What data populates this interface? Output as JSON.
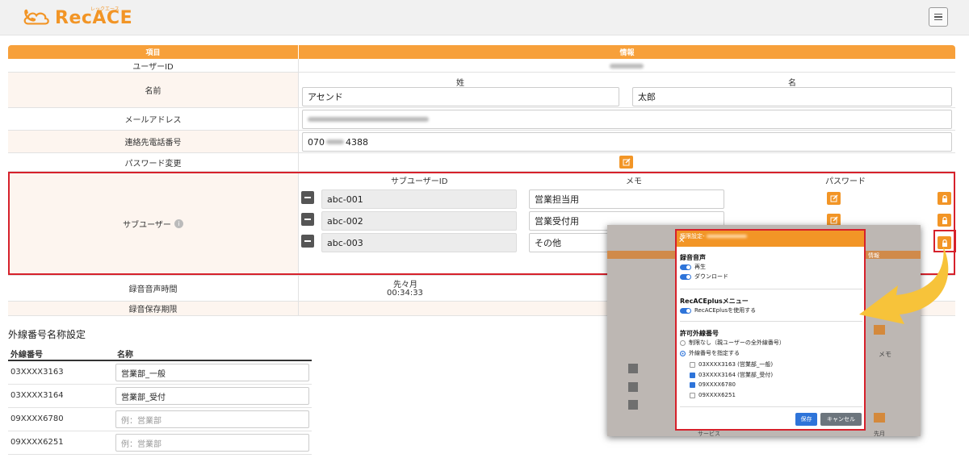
{
  "header": {
    "logo_text": "RecACE",
    "logo_sub": "レックエース"
  },
  "table": {
    "col_item": "項目",
    "col_info": "情報",
    "user_id_label": "ユーザーID",
    "name_label": "名前",
    "last_name_header": "姓",
    "first_name_header": "名",
    "last_name_value": "アセンド",
    "first_name_value": "太郎",
    "email_label": "メールアドレス",
    "phone_label": "連絡先電話番号",
    "phone_prefix": "070",
    "phone_suffix": "4388",
    "password_change_label": "パスワード変更",
    "subuser_label": "サブユーザー",
    "subuser_col_id": "サブユーザーID",
    "subuser_col_memo": "メモ",
    "subuser_col_password": "パスワード",
    "subusers": [
      {
        "id": "abc-001",
        "memo": "営業担当用"
      },
      {
        "id": "abc-002",
        "memo": "営業受付用"
      },
      {
        "id": "abc-003",
        "memo": "その他"
      }
    ],
    "rec_time_label": "録音音声時間",
    "rec_time_period": "先々月",
    "rec_time_value": "00:34:33",
    "rec_keep_label": "録音保存期限"
  },
  "external": {
    "title": "外線番号名称設定",
    "col_number": "外線番号",
    "col_name": "名称",
    "rows": [
      {
        "number": "03XXXX3163",
        "value": "営業部_一般",
        "placeholder": ""
      },
      {
        "number": "03XXXX3164",
        "value": "営業部_受付",
        "placeholder": ""
      },
      {
        "number": "09XXXX6780",
        "value": "",
        "placeholder": "例：営業部"
      },
      {
        "number": "09XXXX6251",
        "value": "",
        "placeholder": "例：営業部"
      }
    ]
  },
  "modal": {
    "title": "権限設定-",
    "sec_recording": "録音音声",
    "play": "再生",
    "download": "ダウンロード",
    "sec_plus": "RecACEplusメニュー",
    "use_plus": "RecACEplusを使用する",
    "sec_allowed": "許可外線番号",
    "no_limit": "制限なし（親ユーザーの全外線番号）",
    "specify": "外線番号を指定する",
    "numbers": [
      {
        "label": "03XXXX3163 (営業部_一般)",
        "checked": false
      },
      {
        "label": "03XXXX3164 (営業部_受付)",
        "checked": true
      },
      {
        "label": "09XXXX6780",
        "checked": true
      },
      {
        "label": "09XXXX6251",
        "checked": false
      }
    ],
    "save": "保存",
    "cancel": "キャンセル"
  },
  "bg_overlay": {
    "info_header": "情報",
    "memo_text": "メモ",
    "period_text": "先月",
    "tab_text": "サービス"
  },
  "colors": {
    "orange": "#f29526",
    "red": "#d6212b",
    "blue": "#2e74d9",
    "arrow": "#f7c33a"
  }
}
